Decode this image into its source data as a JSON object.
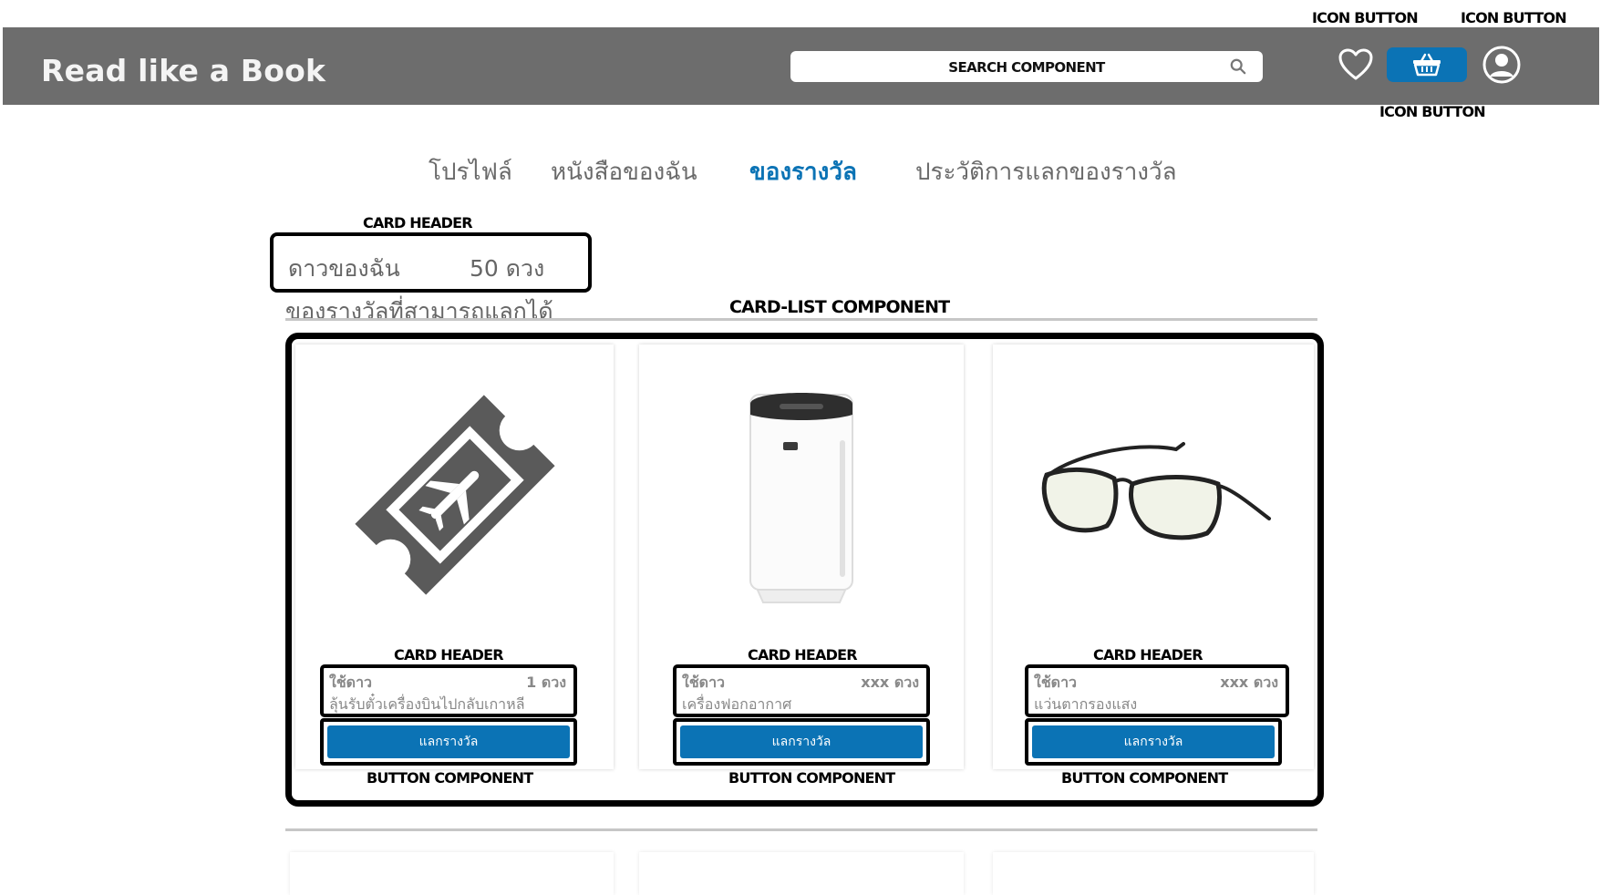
{
  "annotations": {
    "icon_button_1": "ICON BUTTON",
    "icon_button_2": "ICON BUTTON",
    "icon_button_3": "ICON BUTTON",
    "card_header_top": "CARD HEADER",
    "card_list": "CARD-LIST COMPONENT",
    "card_header": "CARD HEADER",
    "button_component": "BUTTON COMPONENT"
  },
  "header": {
    "brand": "Read like a  Book",
    "search_placeholder": "SEARCH COMPONENT"
  },
  "tabs": [
    {
      "label": "โปรไฟล์",
      "active": false
    },
    {
      "label": "หนังสือของฉัน",
      "active": false
    },
    {
      "label": "ของรางวัล",
      "active": true
    },
    {
      "label": "ประวัติการแลกของรางวัล",
      "active": false
    }
  ],
  "stars": {
    "label": "ดาวของฉัน",
    "value": "50  ดวง"
  },
  "section_title": "ของรางวัลที่สามารถแลกได้",
  "rewards": [
    {
      "use_label": "ใช้ดาว",
      "cost": "1  ดวง",
      "name": "ลุ้นรับตั๋วเครื่องบินไปกลับเกาหลี",
      "button": "แลกรางวัล",
      "image": "plane-ticket-icon"
    },
    {
      "use_label": "ใช้ดาว",
      "cost": "xxx  ดวง",
      "name": "เครื่องฟอกอากาศ",
      "button": "แลกรางวัล",
      "image": "air-purifier-image"
    },
    {
      "use_label": "ใช้ดาว",
      "cost": "xxx  ดวง",
      "name": "แว่นตากรองแสง",
      "button": "แลกรางวัล",
      "image": "glasses-image"
    }
  ],
  "colors": {
    "topbar": "#6d6d6d",
    "accent": "#0b73b5",
    "text_gray": "#666666"
  }
}
